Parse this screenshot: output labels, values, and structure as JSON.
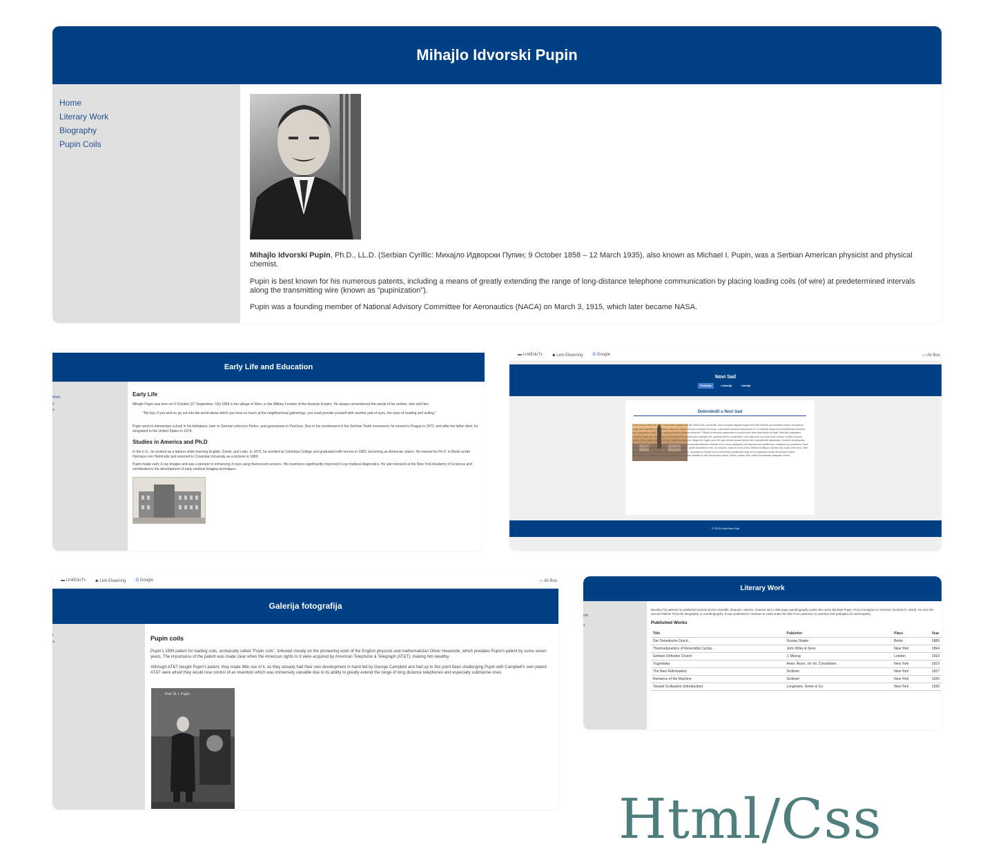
{
  "main": {
    "title": "Mihajlo Idvorski Pupin",
    "nav": [
      "Home",
      "Literary Work",
      "Biography",
      "Pupin Coils"
    ],
    "intro_bold": "Mihajlo Idvorski Pupin",
    "intro_rest": ", Ph.D., LL.D. (Serbian Cyrillic: Михајло Идворски Пупин; 9 October 1858 – 12 March 1935), also known as Michael I. Pupin, was a Serbian American physicist and physical chemist.",
    "para2": "Pupin is best known for his numerous patents, including a means of greatly extending the range of long-distance telephone communication by placing loading coils (of wire) at predetermined intervals along the transmitting wire (known as \"pupinization\").",
    "para3": "Pupin was a founding member of National Advisory Committee for Aeronautics (NACA) on March 3, 1915, which later became NASA."
  },
  "early": {
    "title": "Early Life and Education",
    "h_early": "Early Life",
    "p1": "Mihajlo Pupin was born on 9 October (27 September, OS) 1858 in the village of Idvor, in the Military Frontier of the Austrian Empire. He always remembered the words of his mother, who told him:",
    "quote": "\"My boy, if you wish to go out into the world about which you hear so much at the neighborhood gatherings, you must provide yourself with another pair of eyes, the eyes of reading and writing.\"",
    "p2": "Pupin went to elementary school in his birthplace, later to German school in Perlez, and gymnasium in Pančevo. Due to his involvement in the Serbian Youth movement, he moved to Prague in 1872, and after his father died, he emigrated to the United States in 1874.",
    "h_studies": "Studies in America and Ph.D",
    "p3": "In the U.S., he worked as a laborer while learning English, Greek, and Latin. In 1879, he enrolled at Columbia College and graduated with honors in 1883, becoming an American citizen. He earned his Ph.D. in Berlin under Hermann von Helmholtz and returned to Columbia University as a lecturer in 1889.",
    "p4": "Pupin made early X-ray images and was a pioneer in enhancing X-rays using fluorescent screens. His inventions significantly improved X-ray medical diagnostics. He later lectured at the New York Academy of Sciences and contributed to the development of early medical imaging techniques.",
    "side_frag": [
      "Work",
      "y",
      "s"
    ]
  },
  "novisad": {
    "bookmarks": [
      "LinkEduTv",
      "Link Elearning",
      "Google"
    ],
    "all_bookmarks": "All Boo",
    "title": "Novi Sad",
    "tabs": [
      "Početna",
      "Lokacija",
      "Istorija"
    ],
    "heading": "Dobrodošli u Novi Sad",
    "lorem": "Lorem ipsum dolor sit amet consectetur adipisicing elit. Modi nulla, obcaecati, illum voluptas aliquam fugiat nihil velit incidunt accusantium dolore voluptatum unde iusto blanditiis praesentium natus hic culpa delectus excepturi ducimus. Laboriosam quidem temporibus et. Ex impedit neque ab id repellendus dolorem, eum quisquam id odit, optio minus provident aliquam tempore? Officia et delectus praesentium incidunt sunt vitae quia facilis ab fugit. Delectus voluptates corporis, unde non omnis harum dicta laborum repellendus voluptate est, quaerat odit ex consectetur velit culpa iure eos iusto cum veniam mollitia maiores omnis. Cum, sequi voluptas minus, fugit accusantium. Magni nisi fugiat quod hic quis dolores ipsam facere sed expedita iste aspernatur. Quidem consequatur error sint animi in! Saepe expedita laudantium id recusandae delectus veritatis error omnis quisquam velit aperiam ab repellendus, similique eos possimus. Eum nisi vitae facilis quos accusamus. Voluptatibus sint, quam laudantium rem, ea corporis, dolorum eum ut aut. Minima similique maxime nisi a quis enim eius. Nam elit suscipit ullam. Quisque repellendus dignissimos, accusamus veniam sunt a molestias repellendus fuga rerum quisquam facilis laboriosam dolore doloremque? Tempore perferendis illo hic quo beatae veritatis et odio temporibus ipsum. Minus, eaque nihil, nobis recusandae quisquam omnis.",
    "footer": "© 2023 Grad Novi Sad"
  },
  "gallery": {
    "bookmarks": [
      "LinkEduTv",
      "Link Elearning",
      "Google"
    ],
    "all_bookmarks": "All Boo",
    "title": "Galerija fotografija",
    "heading": "Pupin coils",
    "p1": "Pupin's 1899 patent for loading coils, archaically called \"Pupin coils\", followed closely on the pioneering work of the English physicist and mathematician Oliver Heaviside, which predates Pupin's patent by some seven years. The importance of the patent was made clear when the American rights to it were acquired by American Telephone & Telegraph (AT&T), making him wealthy.",
    "p2": "Although AT&T bought Pupin's patent, they made little use of it, as they already had their own development in hand led by George Campbell and had up to this point been challenging Pupin with Campbell's own patent. AT&T were afraid they would lose control of an invention which was immensely valuable due to its ability to greatly extend the range of long distance telephones and especially submarine ones.",
    "photo_caption": "Prof. M. I. Pupin",
    "side_frag": [
      "l",
      "a"
    ]
  },
  "literary": {
    "title": "Literary Work",
    "intro": "Besides his patents he published several dozen scientific disputes, articles, reviews and a 396-page autobiography under the name Michael Pupin, From Immigrant to Inventor (Scribner's, 1923). He won the annual Pulitzer Prize for Biography or Autobiography. It was published in Serbian in 1929 under the title From pastures to scientist (Od pašnjaka do naučenjaka).",
    "heading": "Published Works",
    "columns": [
      "Title",
      "Publisher",
      "Place",
      "Year"
    ],
    "rows": [
      [
        "Der Osmotische Druck...",
        "Gustav Shade",
        "Berlin",
        "1889"
      ],
      [
        "Thermodynamics of Reversible Cycles...",
        "John Wiley & Sons",
        "New York",
        "1894"
      ],
      [
        "Serbian Orthodox Church",
        "J. Murray",
        "London",
        "1918"
      ],
      [
        "Yugoslavia",
        "Amer. Assoc. for Int. Conciliation",
        "New York",
        "1919"
      ],
      [
        "The New Reformation",
        "Scribner",
        "New York",
        "1927"
      ],
      [
        "Romance of the Machine",
        "Scribner",
        "New York",
        "1930"
      ],
      [
        "Toward Civilization (Introduction)",
        "Longmans, Green & Co.",
        "New York",
        "1930"
      ]
    ],
    "side_frag": [
      "ork",
      "s"
    ]
  },
  "caption": "Html/Css"
}
